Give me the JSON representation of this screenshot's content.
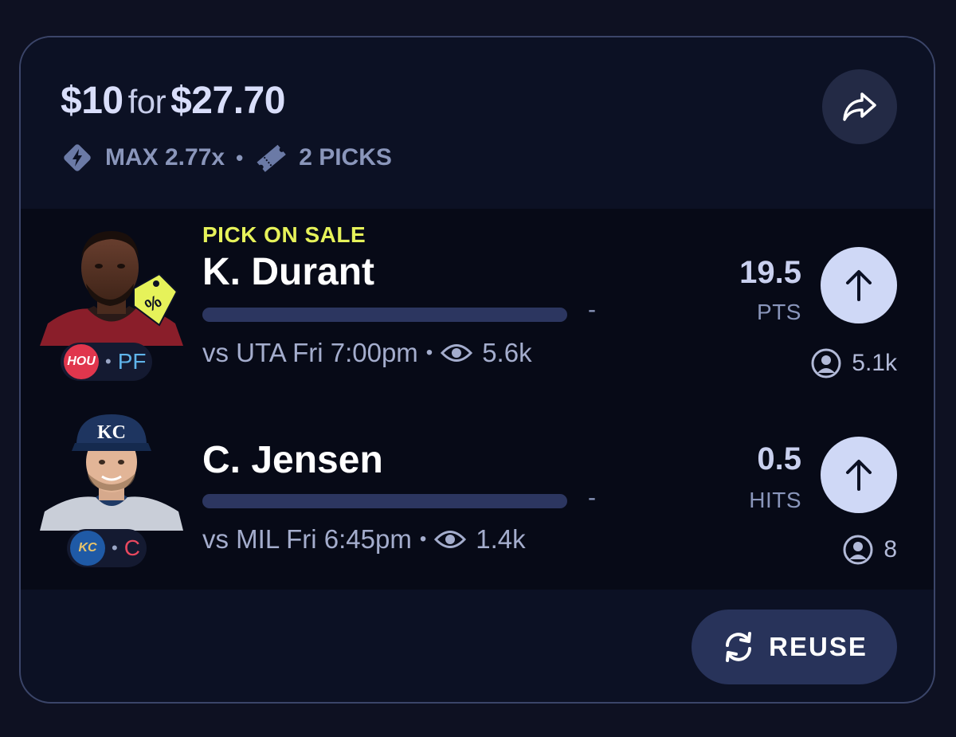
{
  "entry": {
    "stake": "$10",
    "for_text": "for",
    "payout": "$27.70",
    "multiplier": "MAX 2.77x",
    "picks_count": "2 PICKS"
  },
  "icons": {
    "share": "share-arrow-icon",
    "multiplier": "bolt-diamond-icon",
    "picks": "ticket-icon",
    "views": "eye-icon",
    "players": "user-circle-icon",
    "over": "arrow-up-icon",
    "reuse": "refresh-icon",
    "sale": "sale-tag-icon"
  },
  "colors": {
    "accent_sale": "#e6f25a",
    "arrow_button": "#cfd8f6",
    "hou": "#e0364d",
    "kc": "#1f5aa6",
    "pos_pf": "#5fb4ea",
    "pos_c": "#e8485f"
  },
  "picks": [
    {
      "sale_label": "PICK ON SALE",
      "name": "K. Durant",
      "team": "HOU",
      "position": "PF",
      "progress_text": "-",
      "progress": 0,
      "game": "vs UTA Fri 7:00pm",
      "views": "5.6k",
      "line": "19.5",
      "stat": "PTS",
      "pick_count": "5.1k"
    },
    {
      "name": "C. Jensen",
      "team": "KC",
      "position": "C",
      "progress_text": "-",
      "progress": 0,
      "game": "vs MIL Fri 6:45pm",
      "views": "1.4k",
      "line": "0.5",
      "stat": "HITS",
      "pick_count": "8"
    }
  ],
  "actions": {
    "reuse_label": "REUSE"
  }
}
